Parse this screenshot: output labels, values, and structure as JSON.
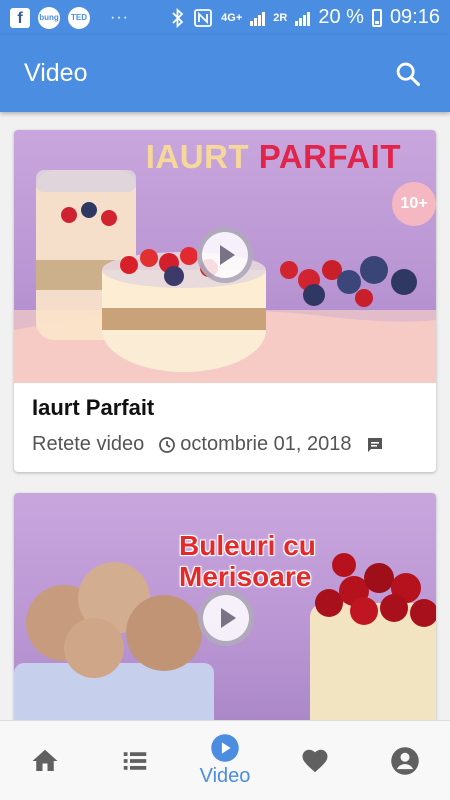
{
  "status_bar": {
    "apps": [
      "f",
      "bung",
      "TED"
    ],
    "more": "···",
    "network_label": "4G+",
    "network_label2": "2R",
    "battery_pct": "20 %",
    "time": "09:16"
  },
  "app_bar": {
    "title": "Video",
    "search_icon": "search-icon"
  },
  "cards": [
    {
      "overlay_word1": "IAURT",
      "overlay_word2": "PARFAIT",
      "badge": "10+",
      "title": "Iaurt Parfait",
      "category": "Retete video",
      "date": "octombrie 01, 2018",
      "comments_icon": "comment-icon"
    },
    {
      "overlay_line1": "Buleuri cu",
      "overlay_line2": "Merisoare"
    }
  ],
  "bottom_nav": {
    "items": [
      {
        "icon": "home-icon"
      },
      {
        "icon": "list-icon"
      },
      {
        "icon": "play-circle-icon",
        "label": "Video",
        "active": true
      },
      {
        "icon": "heart-icon"
      },
      {
        "icon": "account-icon"
      }
    ]
  },
  "colors": {
    "primary": "#4a8de1",
    "inactive_icon": "#606060"
  }
}
